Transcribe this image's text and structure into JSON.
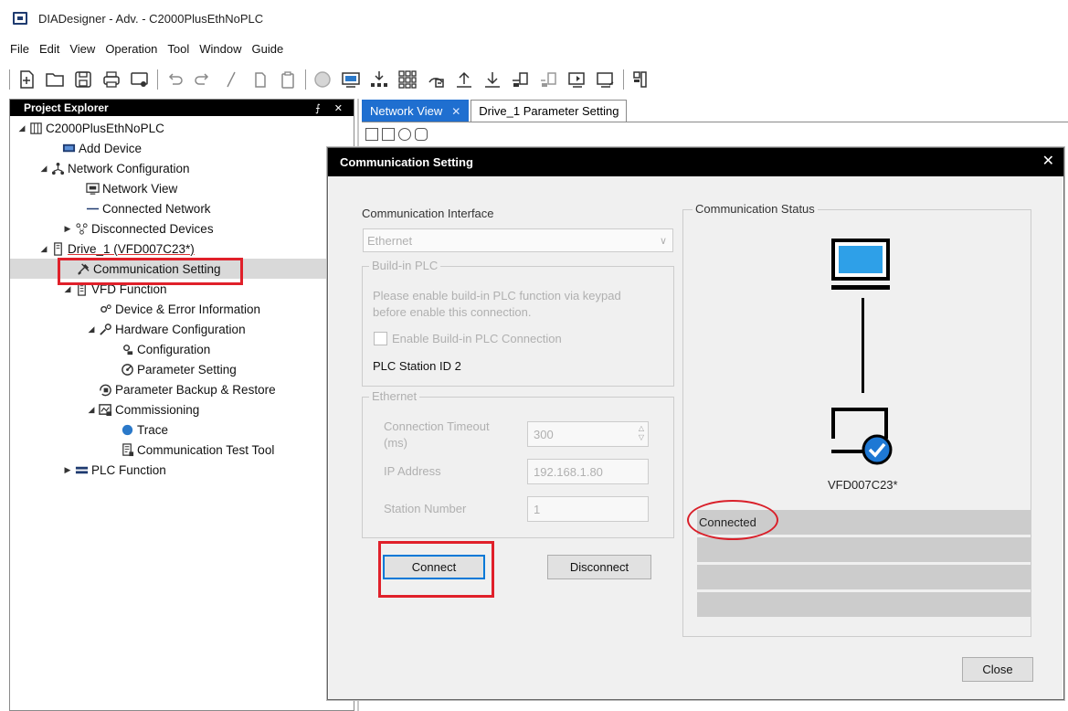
{
  "window": {
    "title": "DIADesigner - Adv. - C2000PlusEthNoPLC"
  },
  "menu": [
    "File",
    "Edit",
    "View",
    "Operation",
    "Tool",
    "Window",
    "Guide"
  ],
  "toolbar_icons": [
    "new-file-icon",
    "open-folder-icon",
    "save-icon",
    "print-icon",
    "print-preview-icon",
    "undo-icon",
    "redo-icon",
    "cut-icon",
    "copy-icon",
    "paste-icon",
    "stop-icon",
    "monitor-icon",
    "download-network-icon",
    "grid-icon",
    "scan-icon",
    "upload-icon",
    "download-icon",
    "connect-device-icon",
    "disconnect-device-icon",
    "go-online-icon",
    "go-offline-icon",
    "layout-icon"
  ],
  "explorer": {
    "title": "Project Explorer",
    "pin_close": "⨍ ✕",
    "items": [
      {
        "label": "C2000PlusEthNoPLC",
        "arrow": "◢",
        "icon": "project-icon"
      },
      {
        "label": "Add Device",
        "arrow": "",
        "icon": "add-device-icon"
      },
      {
        "label": "Network Configuration",
        "arrow": "◢",
        "icon": "network-icon"
      },
      {
        "label": "Network View",
        "arrow": "",
        "icon": "network-view-icon"
      },
      {
        "label": "Connected Network",
        "arrow": "",
        "icon": "connected-network-icon"
      },
      {
        "label": "Disconnected Devices",
        "arrow": "▶",
        "icon": "disconnected-devices-icon"
      },
      {
        "label": "Drive_1 (VFD007C23*)",
        "arrow": "◢",
        "icon": "drive-icon"
      },
      {
        "label": "Communication Setting",
        "arrow": "",
        "icon": "communication-icon"
      },
      {
        "label": "VFD Function",
        "arrow": "◢",
        "icon": "vfd-function-icon"
      },
      {
        "label": "Device & Error Information",
        "arrow": "",
        "icon": "device-info-icon"
      },
      {
        "label": "Hardware Configuration",
        "arrow": "◢",
        "icon": "hardware-icon"
      },
      {
        "label": "Configuration",
        "arrow": "",
        "icon": "configuration-icon"
      },
      {
        "label": "Parameter Setting",
        "arrow": "",
        "icon": "parameter-icon"
      },
      {
        "label": "Parameter Backup & Restore",
        "arrow": "",
        "icon": "backup-icon"
      },
      {
        "label": "Commissioning",
        "arrow": "◢",
        "icon": "commissioning-icon"
      },
      {
        "label": "Trace",
        "arrow": "",
        "icon": "trace-icon"
      },
      {
        "label": "Communication Test Tool",
        "arrow": "",
        "icon": "test-tool-icon"
      },
      {
        "label": "PLC Function",
        "arrow": "▶",
        "icon": "plc-function-icon"
      }
    ]
  },
  "tabs": [
    {
      "label": "Network View",
      "close": "✕"
    },
    {
      "label": "Drive_1 Parameter Setting"
    }
  ],
  "dialog": {
    "title": "Communication Setting",
    "close": "✕",
    "interface_label": "Communication Interface",
    "interface_value": "Ethernet",
    "combo_arrow": "∨",
    "buildin": {
      "title": "Build-in PLC",
      "note_line1": "Please enable build-in PLC function via keypad",
      "note_line2": "before enable this connection.",
      "checkbox_label": "Enable Build-in PLC Connection",
      "station_id": "PLC Station ID  2"
    },
    "ethernet": {
      "title": "Ethernet",
      "timeout_label_line1": "Connection Timeout",
      "timeout_label_line2": "(ms)",
      "timeout_value": "300",
      "ip_label": "IP Address",
      "ip_value": "192.168.1.80",
      "station_label": "Station Number",
      "station_value": "1"
    },
    "connect_label": "Connect",
    "disconnect_label": "Disconnect",
    "status": {
      "title": "Communication Status",
      "device_name": "VFD007C23*",
      "rows": [
        "Connected",
        "",
        "",
        ""
      ]
    },
    "close_label": "Close"
  },
  "colors": {
    "accent": "#1f6fd0",
    "highlight": "#e0202a",
    "computer": "#2ea0e8",
    "check": "#1e78d4"
  }
}
